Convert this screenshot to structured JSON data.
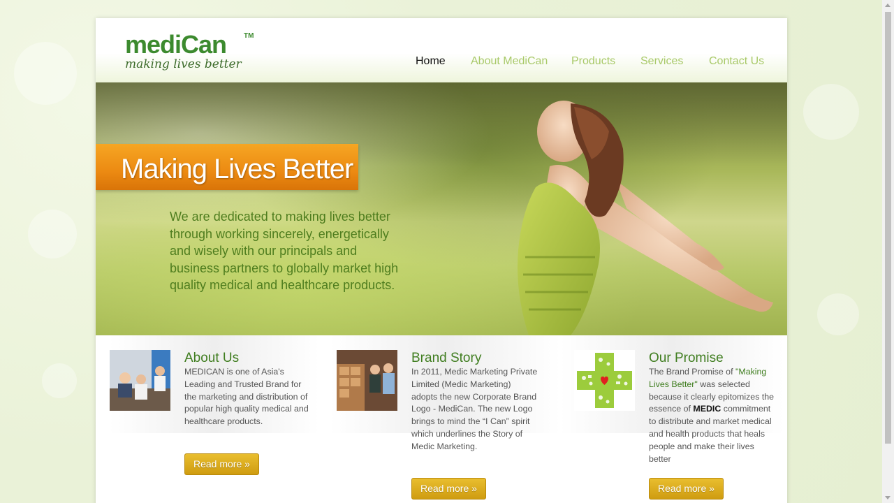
{
  "brand": {
    "logo_main_1": "medi",
    "logo_main_2": "C",
    "logo_main_3": "an",
    "logo_tm": "TM",
    "tagline": "making lives better",
    "color_primary": "#3c8a2e",
    "color_accent": "#8cc63f"
  },
  "nav": {
    "items": [
      {
        "label": "Home",
        "active": true
      },
      {
        "label": "About MediCan",
        "active": false
      },
      {
        "label": "Products",
        "active": false
      },
      {
        "label": "Services",
        "active": false
      },
      {
        "label": "Contact Us",
        "active": false
      }
    ]
  },
  "hero": {
    "banner": "Making Lives Better",
    "copy": "We are dedicated to making lives better through working sincerely, energetically and wisely with our principals and business partners to globally market high quality medical and healthcare products."
  },
  "features": [
    {
      "title": "About Us",
      "text": "MEDICAN is one of Asia's Leading and Trusted Brand for the marketing and distribution of popular high quality medical and healthcare products.",
      "button": "Read more »",
      "thumb_icon": "meeting-photo-icon"
    },
    {
      "title": "Brand Story",
      "text": "In 2011, Medic Marketing Private Limited (Medic Marketing) adopts the new Corporate Brand Logo - MediCan. The new Logo brings to mind the “I Can” spirit which underlines the Story of Medic Marketing.",
      "button": "Read more »",
      "thumb_icon": "warehouse-photo-icon"
    },
    {
      "title": "Our Promise",
      "text_part1": "The Brand Promise of ",
      "text_quote": "\"Making Lives Better\"",
      "text_part2": " was selected because it clearly epitomizes the essence of ",
      "text_bold": "MEDIC",
      "text_part3": " commitment to distribute and market medical and health products that heals people and make their lives better",
      "button": "Read more »",
      "thumb_icon": "health-cross-icon"
    }
  ],
  "colors": {
    "button_gold": "#d9a81c",
    "nav_inactive": "#a8c968",
    "banner_orange": "#ec8a12"
  }
}
